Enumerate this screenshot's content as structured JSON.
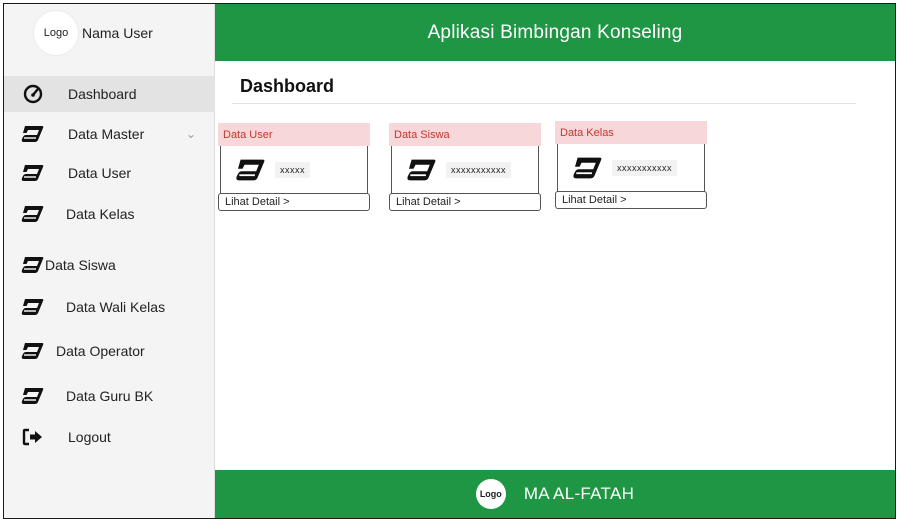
{
  "sidebar": {
    "logo_text": "Logo",
    "user_name": "Nama User",
    "items": [
      {
        "label": "Dashboard",
        "icon": "dashboard-gauge-icon"
      },
      {
        "label": "Data Master",
        "icon": "book-icon",
        "chevron": "⌄"
      },
      {
        "label": "Data User",
        "icon": "book-icon"
      },
      {
        "label": "Data Kelas",
        "icon": "book-icon"
      },
      {
        "label": "Data Siswa",
        "icon": "book-icon"
      },
      {
        "label": "Data Wali Kelas",
        "icon": "book-icon"
      },
      {
        "label": "Data Operator",
        "icon": "book-icon"
      },
      {
        "label": "Data Guru BK",
        "icon": "book-icon"
      },
      {
        "label": "Logout",
        "icon": "logout-icon"
      }
    ]
  },
  "header": {
    "title": "Aplikasi Bimbingan Konseling"
  },
  "main": {
    "page_title": "Dashboard",
    "cards": [
      {
        "title": "Data User",
        "value": "xxxxx",
        "link": "Lihat Detail >"
      },
      {
        "title": "Data Siswa",
        "value": "xxxxxxxxxxx",
        "link": "Lihat Detail >"
      },
      {
        "title": "Data Kelas",
        "value": "xxxxxxxxxxx",
        "link": "Lihat Detail >"
      }
    ]
  },
  "footer": {
    "logo_text": "Logo",
    "school_name": "MA AL-FATAH"
  },
  "colors": {
    "primary_green": "#1e9644",
    "card_header_bg": "#f8d7da",
    "card_header_text": "#c0392b"
  }
}
